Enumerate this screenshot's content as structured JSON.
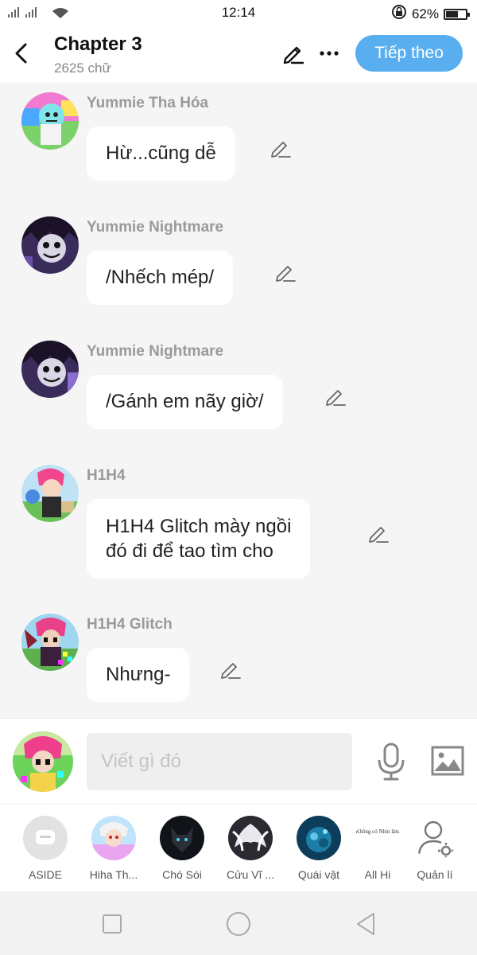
{
  "status_bar": {
    "time": "12:14",
    "battery": "62%",
    "battery_level": 0.62
  },
  "header": {
    "title": "Chapter 3",
    "word_count": "2625 chữ",
    "next_label": "Tiếp theo"
  },
  "messages": [
    {
      "sender": "Yummie Tha Hóa",
      "lines": [
        "Hừ...cũng dễ"
      ]
    },
    {
      "sender": "Yummie Nightmare",
      "lines": [
        "/Nhếch mép/"
      ]
    },
    {
      "sender": "Yummie Nightmare",
      "lines": [
        "/Gánh em nãy giờ/"
      ]
    },
    {
      "sender": "H1H4",
      "lines": [
        "H1H4 Glitch mày ngồi",
        "đó đi để tao tìm cho"
      ]
    },
    {
      "sender": "H1H4 Glitch",
      "lines": [
        "Nhưng-"
      ]
    }
  ],
  "composer": {
    "placeholder": "Viết gì đó"
  },
  "characters": [
    {
      "name": "ASIDE"
    },
    {
      "name": "Hiha Th..."
    },
    {
      "name": "Chó Sói"
    },
    {
      "name": "Cửu Vĩ ..."
    },
    {
      "name": "Quái vật"
    },
    {
      "name": "All Hi",
      "avatar_text": "Không có Nhìn làm"
    },
    {
      "name": "Quản lí"
    }
  ],
  "icons": {
    "back": "chevron-left-icon",
    "edit": "pencil-icon",
    "more": "more-dots-icon",
    "mic": "microphone-icon",
    "image": "image-icon",
    "settings": "user-settings-icon"
  },
  "colors": {
    "accent": "#58aeee",
    "sender": "#9a9a9a",
    "background": "#f5f5f5"
  }
}
